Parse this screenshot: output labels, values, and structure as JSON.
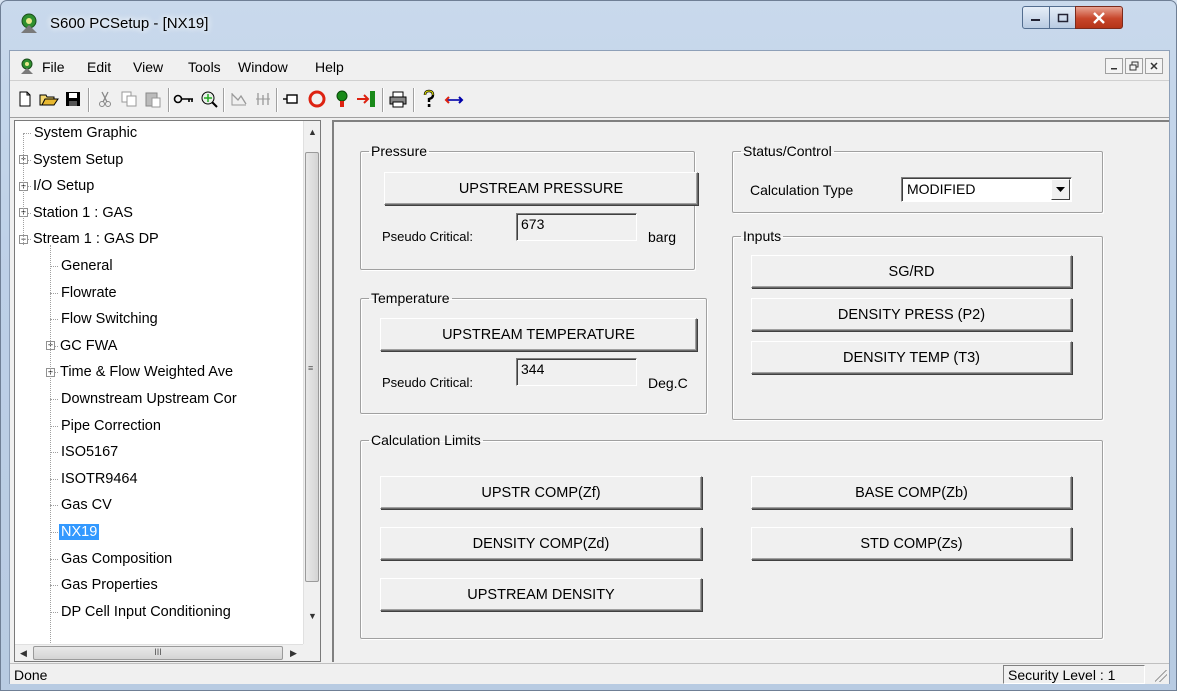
{
  "window": {
    "title": "S600 PCSetup - [NX19]"
  },
  "menubar": {
    "items": [
      "File",
      "Edit",
      "View",
      "Tools",
      "Window",
      "Help"
    ]
  },
  "toolbar": {
    "icons": [
      "new-icon",
      "open-icon",
      "save-icon",
      "cut-icon",
      "copy-icon",
      "paste-icon",
      "key-icon",
      "connect-icon",
      "graph-icon",
      "bars-icon",
      "stop-icon",
      "alarm-icon",
      "tree-icon",
      "exit-icon",
      "print-icon",
      "help-icon",
      "swap-icon"
    ]
  },
  "tree": {
    "items": [
      {
        "label": "System Graphic",
        "expander": "",
        "level": 0
      },
      {
        "label": "System Setup",
        "expander": "+",
        "level": 0
      },
      {
        "label": "I/O Setup",
        "expander": "+",
        "level": 0
      },
      {
        "label": "Station 1 : GAS",
        "expander": "+",
        "level": 0
      },
      {
        "label": "Stream 1 : GAS DP",
        "expander": "−",
        "level": 0
      },
      {
        "label": "General",
        "expander": "",
        "level": 1
      },
      {
        "label": "Flowrate",
        "expander": "",
        "level": 1
      },
      {
        "label": "Flow Switching",
        "expander": "",
        "level": 1
      },
      {
        "label": "GC FWA",
        "expander": "+",
        "level": 1
      },
      {
        "label": "Time & Flow Weighted Ave",
        "expander": "+",
        "level": 1
      },
      {
        "label": "Downstream Upstream Cor",
        "expander": "",
        "level": 1
      },
      {
        "label": "Pipe Correction",
        "expander": "",
        "level": 1
      },
      {
        "label": "ISO5167",
        "expander": "",
        "level": 1
      },
      {
        "label": "ISOTR9464",
        "expander": "",
        "level": 1
      },
      {
        "label": "Gas CV",
        "expander": "",
        "level": 1
      },
      {
        "label": "NX19",
        "expander": "",
        "level": 1,
        "selected": true
      },
      {
        "label": "Gas Composition",
        "expander": "",
        "level": 1
      },
      {
        "label": "Gas Properties",
        "expander": "",
        "level": 1
      },
      {
        "label": "DP Cell Input Conditioning",
        "expander": "",
        "level": 1
      }
    ],
    "hscroll_grip": "III"
  },
  "pressure": {
    "legend": "Pressure",
    "button": "UPSTREAM PRESSURE",
    "label": "Pseudo Critical:",
    "value": "673",
    "unit": "barg"
  },
  "temperature": {
    "legend": "Temperature",
    "button": "UPSTREAM TEMPERATURE",
    "label": "Pseudo Critical:",
    "value": "344",
    "unit": "Deg.C"
  },
  "status_control": {
    "legend": "Status/Control",
    "label": "Calculation Type",
    "selected": "MODIFIED"
  },
  "inputs": {
    "legend": "Inputs",
    "buttons": [
      "SG/RD",
      "DENSITY PRESS (P2)",
      "DENSITY TEMP (T3)"
    ]
  },
  "calc_limits": {
    "legend": "Calculation Limits",
    "buttons": [
      "UPSTR COMP(Zf)",
      "DENSITY COMP(Zd)",
      "UPSTREAM DENSITY",
      "BASE COMP(Zb)",
      "STD COMP(Zs)"
    ]
  },
  "statusbar": {
    "left": "Done",
    "right": "Security Level : 1"
  },
  "colors": {
    "selection": "#3399ff",
    "close_button": "#c7462b"
  }
}
